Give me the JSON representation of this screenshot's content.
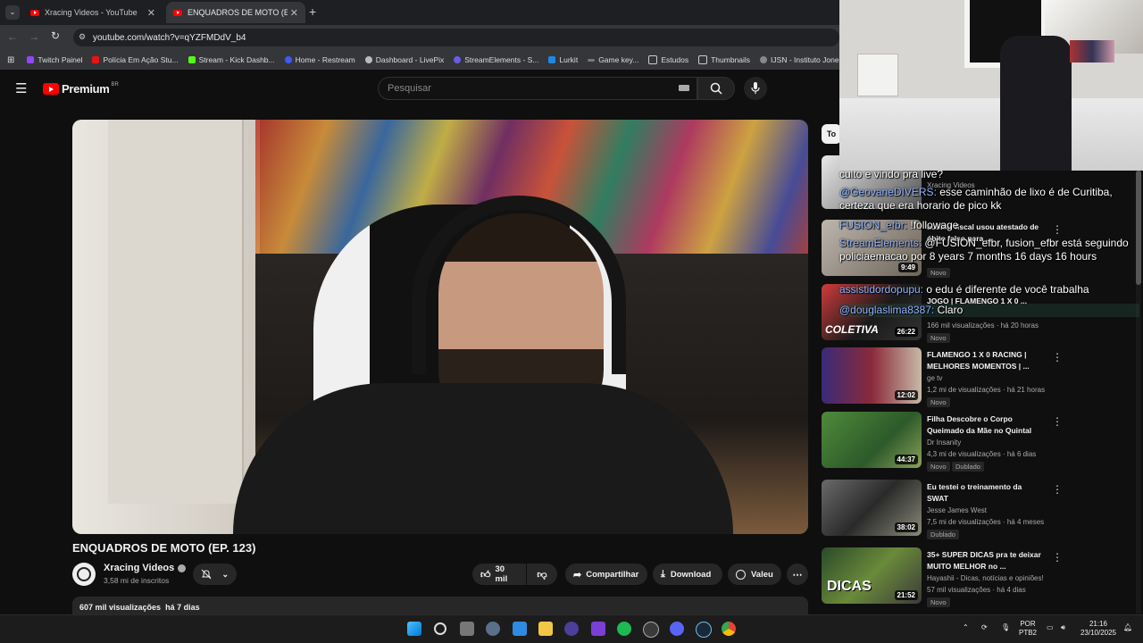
{
  "tabs": [
    {
      "label": "Xracing Videos - YouTube"
    },
    {
      "label": "ENQUADROS DE MOTO (EP. 12"
    }
  ],
  "url": "youtube.com/watch?v=qYZFMDdV_b4",
  "bookmarks": [
    "Twitch Painel",
    "Polícia Em Ação Stu...",
    "Stream - Kick Dashb...",
    "Home - Restream",
    "Dashboard - LivePix",
    "StreamElements - S...",
    "Lurkit",
    "Game key...",
    "Estudos",
    "Thumbnails",
    "IJSN - Instituto Jone..."
  ],
  "header": {
    "logo": "Premium",
    "region": "BR",
    "search_placeholder": "Pesquisar"
  },
  "video": {
    "title": "ENQUADROS DE MOTO (EP. 123)",
    "channel": "Xracing Videos",
    "subscribers": "3,58 mi de inscritos",
    "likes": "30 mil",
    "share": "Compartilhar",
    "download": "Download",
    "thanks": "Valeu",
    "views": "607 mil visualizações",
    "age": "há 7 dias"
  },
  "sidebar": {
    "chip": "To",
    "items": [
      {
        "title": "auditor fiscal usou atestado de óbito falso para ...",
        "channel": "",
        "meta": "",
        "duration": "9:49",
        "badge": "Novo"
      },
      {
        "title": "JOGO | FLAMENGO 1 X 0 ...",
        "channel": "",
        "meta": "166 mil visualizações · há 20 horas",
        "duration": "26:22",
        "badge": "Novo",
        "thumb_text": "COLETIVA"
      },
      {
        "title": "FLAMENGO 1 X 0 RACING | MELHORES MOMENTOS | ...",
        "channel": "ge tv",
        "meta": "1,2 mi de visualizações · há 21 horas",
        "duration": "12:02",
        "badge": "Novo"
      },
      {
        "title": "Filha Descobre o Corpo Queimado da Mãe no Quintal",
        "channel": "Dr Insanity",
        "meta": "4,3 mi de visualizações · há 6 dias",
        "duration": "44:37",
        "badge": "Novo",
        "badge2": "Dublado"
      },
      {
        "title": "Eu testei o treinamento da SWAT",
        "channel": "Jesse James West",
        "meta": "7,5 mi de visualizações · há 4 meses",
        "duration": "38:02",
        "badge": "Dublado"
      },
      {
        "title": "35+ SUPER DICAS pra te deixar MUITO MELHOR no ...",
        "channel": "Hayashii - Dicas, notícias e opiniões!",
        "meta": "57 mil visualizações · há 4 dias",
        "duration": "21:52",
        "badge": "Novo",
        "thumb_text": "DICAS"
      }
    ],
    "partial_channel": "Xracing Videos",
    "partial_title": "culto e vindo pra live?"
  },
  "chat": [
    {
      "user": "",
      "text": "culto e vindo pra live?"
    },
    {
      "user": "@GeovaneDIVERS:",
      "text": "esse caminhão de lixo é de Curitiba, certeza que era horario de pico kk"
    },
    {
      "user": "FUSION_efbr:",
      "text": "!followage"
    },
    {
      "user": "StreamElements:",
      "text": "@FUSION_efbr, fusion_efbr está seguindo policiaemacao por 8 years 7 months 16 days 16 hours"
    },
    {
      "user": "assistidordopupu:",
      "text": "o edu é diferente de você trabalha"
    },
    {
      "user": "@douglaslima8387:",
      "text": "Claro"
    }
  ],
  "taskbar": {
    "lang": "POR",
    "layout": "PTB2",
    "time": "21:16",
    "date": "23/10/2025"
  }
}
